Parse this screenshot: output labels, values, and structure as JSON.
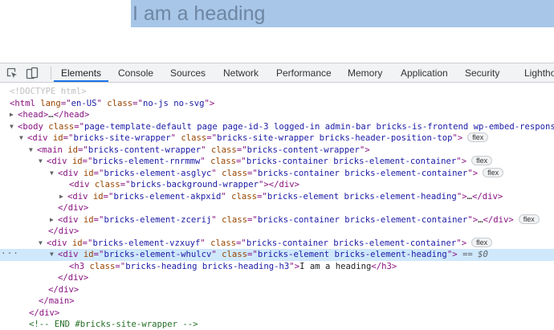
{
  "page": {
    "heading": "I am a heading"
  },
  "devtools": {
    "tabs": [
      "Elements",
      "Console",
      "Sources",
      "Network",
      "Performance",
      "Memory",
      "Application",
      "Security",
      "Lighthouse"
    ],
    "active_tab": "Elements",
    "flex_badge": "flex",
    "selected_marker": "== $0",
    "dom": {
      "doctype": "<!DOCTYPE html>",
      "html_open": "html",
      "html_attrs": [
        [
          "lang",
          "en-US"
        ],
        [
          "class",
          "no-js no-svg"
        ]
      ],
      "head": "head",
      "body_open": "body",
      "body_class": "page-template-default page page-id-3 logged-in admin-bar bricks-is-frontend wp-embed-responsive",
      "site_wrapper_id": "bricks-site-wrapper",
      "site_wrapper_class": "bricks-site-wrapper bricks-header-position-top",
      "main_id": "bricks-content-wrapper",
      "main_class": "bricks-content-wrapper",
      "c1_id": "bricks-element-rnrmmw",
      "container_class": "bricks-container bricks-element-container",
      "c2_id": "bricks-element-asglyc",
      "bg_wrapper_class": "bricks-background-wrapper",
      "akpxid_id": "bricks-element-akpxid",
      "heading_el_class": "bricks-element bricks-element-heading",
      "zcerij_id": "bricks-element-zcerij",
      "vzxuyf_id": "bricks-element-vzxuyf",
      "whulcv_id": "bricks-element-whulcv",
      "h3_class": "bricks-heading bricks-heading-h3",
      "h3_text": "I am a heading",
      "comment": "<!-- END #bricks-site-wrapper -->"
    }
  }
}
